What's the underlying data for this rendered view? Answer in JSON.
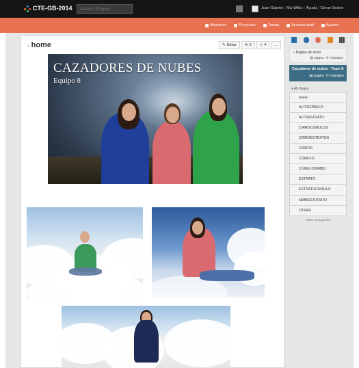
{
  "topbar": {
    "project": "CTE-GB-2014",
    "search_placeholder": "Search Project",
    "user_name": "Juan-Gabriel",
    "my_wikis": "Mis Wikis",
    "help": "Ayuda",
    "logout": "Cerrar Sesión"
  },
  "menu": {
    "items": [
      {
        "label": "Miembros",
        "icon": "people-icon"
      },
      {
        "label": "Proyectos",
        "icon": "projects-icon"
      },
      {
        "label": "Tareas",
        "icon": "tasks-icon"
      },
      {
        "label": "Accesos total",
        "icon": "access-icon"
      },
      {
        "label": "Ajustes",
        "icon": "gear-icon"
      }
    ]
  },
  "page": {
    "title": "home",
    "edit_label": "Editar",
    "comments_count": "0",
    "followers_count": "4",
    "more_label": "..."
  },
  "hero": {
    "title": "CAZADORES DE NUBES",
    "subtitle": "Equipo 8"
  },
  "sidebar": {
    "home_link": "Página de inicio",
    "home_pages": "pages",
    "home_changes": "changes",
    "team_name": "Cazadores de nubes - Team 8",
    "team_pages": "pages",
    "team_changes": "changes",
    "all_pages": "All Pages",
    "pages": [
      "home",
      "ALTOCÚMULO",
      "ALTOESTRATO",
      "CIRROCÚMULOS",
      "CIRROESTRATOS",
      "CIRROS",
      "CÚMULO",
      "CÚMULONIMBO",
      "ESTRATO",
      "ESTRATOCÚMULO",
      "NIMBOESTRATO",
      "OTRAS"
    ],
    "edit_nav": "editar navegación"
  },
  "colors": {
    "topbar": "#151515",
    "accent": "#e8714f",
    "team_panel": "#3c6d84"
  }
}
